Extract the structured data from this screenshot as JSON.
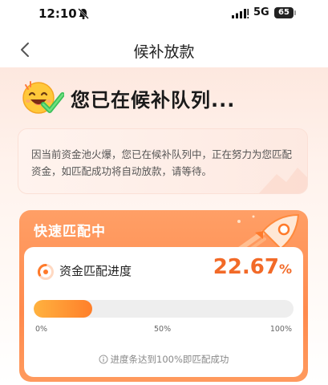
{
  "status_bar": {
    "time": "12:10",
    "network": "5G",
    "battery": "65"
  },
  "nav": {
    "title": "候补放款"
  },
  "hero": {
    "title": "您已在候补队列..."
  },
  "notice": {
    "text": "因当前资金池火爆，您已在候补队列中，正在努力为您匹配资金，如匹配成功将自动放款，请等待。"
  },
  "match": {
    "title": "快速匹配中",
    "progress_label": "资金匹配进度",
    "progress_value": "22.67",
    "progress_unit": "%",
    "progress_fraction": 0.2267,
    "ticks": [
      "0%",
      "50%",
      "100%"
    ],
    "hint": "进度条达到100%即匹配成功"
  },
  "colors": {
    "accent": "#f26a28",
    "card": "#ff8a4d",
    "bar_start": "#ffb23f",
    "bar_end": "#ff7f2a"
  },
  "icons": [
    "bell-muted-icon",
    "signal-icon",
    "back-icon",
    "emoji-icon",
    "rocket-icon",
    "progress-ring-icon",
    "info-icon"
  ]
}
